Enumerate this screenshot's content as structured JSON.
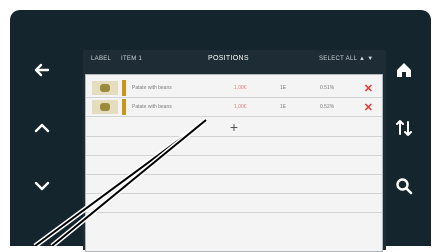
{
  "topbar": {
    "left1": "LABEL",
    "left2": "ITEM 1",
    "title": "POSITIONS",
    "right": "SELECT ALL ▲ ▼"
  },
  "rows": [
    {
      "name": "Patate with beans",
      "price": "1,00€",
      "qty": "1E",
      "code": "0.51%"
    },
    {
      "name": "Patate with beans",
      "price": "1,00€",
      "qty": "1E",
      "code": "0.52%"
    }
  ],
  "add_label": "+",
  "icons": {
    "left": [
      "arrow-left-icon",
      "chevron-up-icon",
      "chevron-down-icon"
    ],
    "right": [
      "home-icon",
      "swap-vertical-icon",
      "search-icon"
    ]
  },
  "colors": {
    "bezel": "#15252e",
    "delete": "#e53935",
    "accent_bar": "#c8951f"
  }
}
